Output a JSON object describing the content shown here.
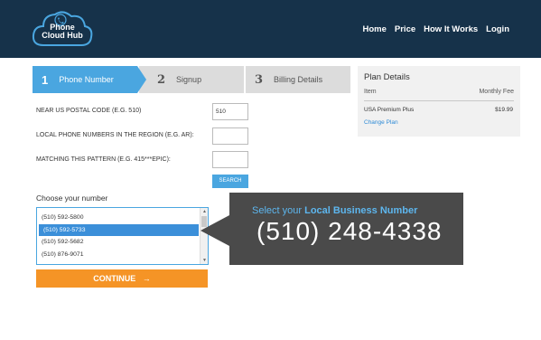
{
  "header": {
    "logo_line1": "Phone",
    "logo_line2": "Cloud Hub",
    "nav": [
      "Home",
      "Price",
      "How It Works",
      "Login"
    ]
  },
  "steps": [
    {
      "num": "1",
      "label": "Phone Number"
    },
    {
      "num": "2",
      "label": "Signup"
    },
    {
      "num": "3",
      "label": "Billing Details"
    }
  ],
  "form": {
    "postal_label": "NEAR US POSTAL CODE (E.G. 510)",
    "postal_value": "510",
    "region_label": "LOCAL PHONE NUMBERS IN THE REGION (E.G. AR):",
    "region_value": "",
    "pattern_label": "MATCHING THIS PATTERN (E.G. 415***EPIC):",
    "pattern_value": "",
    "search_button": "SEARCH"
  },
  "choose": {
    "label": "Choose your number",
    "options": [
      "(510) 592-5800",
      "(510) 592-5733",
      "(510) 592-5682",
      "(510) 876-9071"
    ],
    "selected_index": 1
  },
  "continue_button": "CONTINUE",
  "plan": {
    "title": "Plan Details",
    "col_item": "Item",
    "col_fee": "Monthly Fee",
    "item_name": "USA Premium Plus",
    "item_price": "$19.99",
    "change_link": "Change Plan"
  },
  "callout": {
    "prefix": "Select your ",
    "highlight": "Local Business Number",
    "phone": "(510) 248-4338"
  },
  "colors": {
    "header_bg": "#16324a",
    "accent_blue": "#4aa6e0",
    "orange": "#f59426",
    "callout_bg": "#4a4a4a"
  }
}
